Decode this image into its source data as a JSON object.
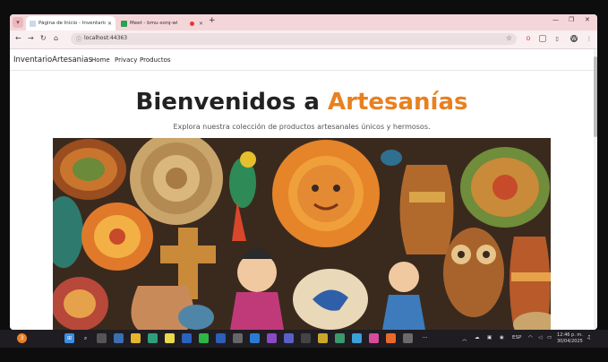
{
  "browser": {
    "tabs": [
      {
        "title": "Página de Inicio - InventarioAr",
        "active": true
      },
      {
        "title": "Meet - bmu-sorq-wi",
        "active": false
      }
    ],
    "address": "localhost:44363",
    "colors": {
      "tabstrip": "#f4d6d9",
      "toolbar": "#f9eef0"
    }
  },
  "site": {
    "brand": "InventarioArtesanias",
    "nav": [
      "Home",
      "Privacy",
      "Productos"
    ],
    "hero": {
      "title_prefix": "Bienvenidos a ",
      "title_accent": "Artesanías",
      "subtitle": "Explora nuestra colección de productos artesanales únicos y hermosos.",
      "accent_color": "#e9801f"
    }
  },
  "taskbar": {
    "notification_count": "3",
    "lang": "ESP",
    "time": "12:46 p. m.",
    "date": "30/04/2025"
  }
}
